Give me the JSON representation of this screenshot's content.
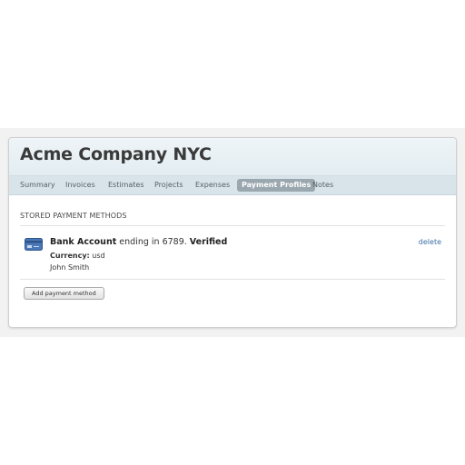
{
  "header": {
    "title": "Acme Company NYC"
  },
  "tabs": [
    {
      "label": "Summary",
      "active": false
    },
    {
      "label": "Invoices",
      "active": false
    },
    {
      "label": "Estimates",
      "active": false
    },
    {
      "label": "Projects",
      "active": false
    },
    {
      "label": "Expenses",
      "active": false
    },
    {
      "label": "Payment Profiles",
      "active": true
    },
    {
      "label": "Notes",
      "active": false
    }
  ],
  "section": {
    "heading": "STORED PAYMENT METHODS"
  },
  "payment_method": {
    "icon": "credit-card-icon",
    "type": "Bank Account",
    "ending_text": "ending in 6789.",
    "status": "Verified",
    "currency_label": "Currency:",
    "currency_value": "usd",
    "holder": "John Smith",
    "delete_label": "delete"
  },
  "actions": {
    "add_label": "Add payment method"
  },
  "colors": {
    "header_bg": "#e3edf2",
    "tabbar_bg": "#d8e4ea",
    "active_tab_bg": "#9aa7ae",
    "link": "#3a6ea5",
    "card_icon": "#4a78b8"
  }
}
